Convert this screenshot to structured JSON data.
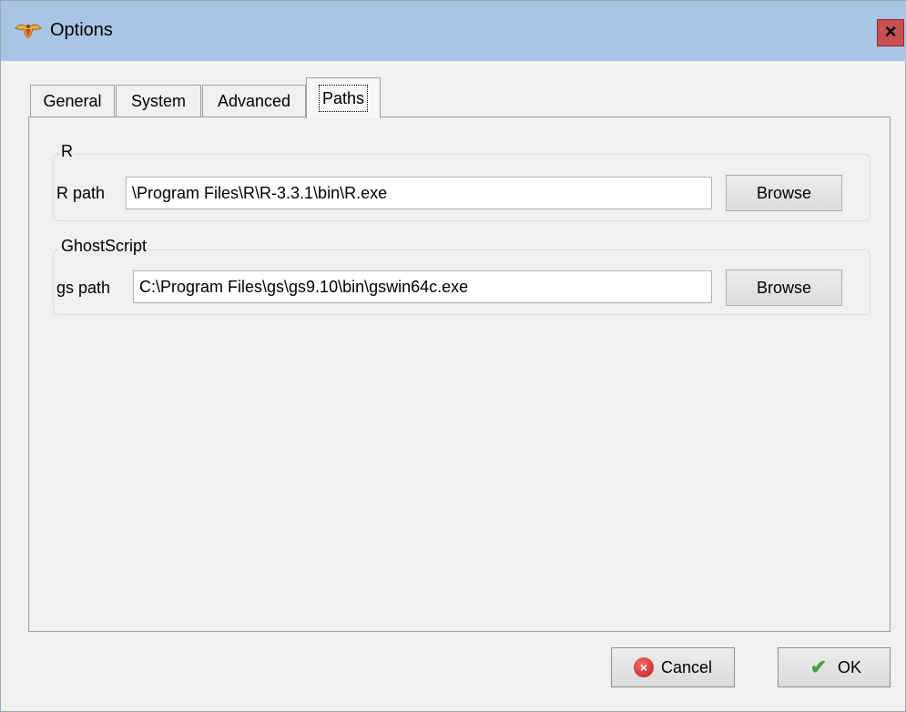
{
  "window": {
    "title": "Options",
    "close_glyph": "×"
  },
  "tabs": [
    {
      "label": "General",
      "active": false
    },
    {
      "label": "System",
      "active": false
    },
    {
      "label": "Advanced",
      "active": false
    },
    {
      "label": "Paths",
      "active": true
    }
  ],
  "r_group": {
    "title": "R",
    "field_label": "R path",
    "value": "\\Program Files\\R\\R-3.3.1\\bin\\R.exe",
    "browse_label": "Browse"
  },
  "gs_group": {
    "title": "GhostScript",
    "field_label": "gs path",
    "value": "C:\\Program Files\\gs\\gs9.10\\bin\\gswin64c.exe",
    "browse_label": "Browse"
  },
  "footer": {
    "cancel_label": "Cancel",
    "ok_label": "OK",
    "cancel_icon_glyph": "×",
    "ok_icon_glyph": "✔"
  },
  "icons": {
    "app_icon": "app-logo-icon",
    "close_icon": "close-icon",
    "cancel_icon": "cancel-icon",
    "ok_icon": "checkmark-icon"
  },
  "colors": {
    "titlebar": "#aac4e4",
    "close_button": "#c75050",
    "window_bg": "#f0f0f0"
  }
}
